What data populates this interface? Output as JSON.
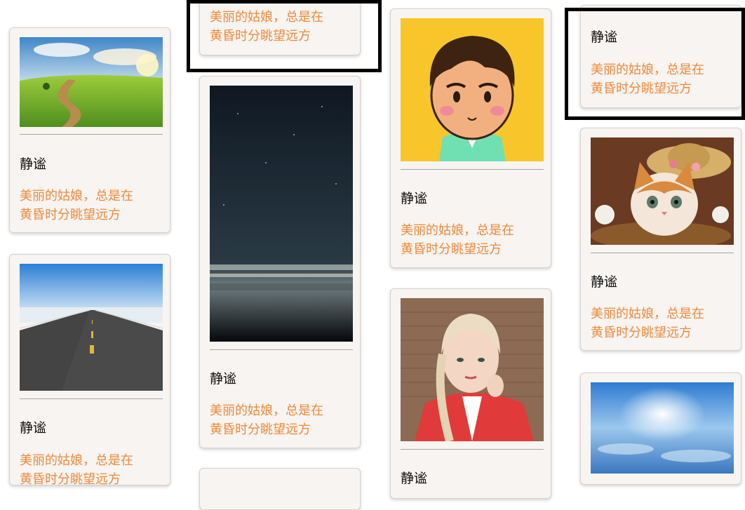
{
  "cards": [
    {
      "name": "静谧",
      "desc_line1": "美丽的姑娘，总是在",
      "desc_line2": "黄昏时分眺望远方",
      "image": "green-hills-landscape-photo"
    },
    {
      "name": "静谧",
      "desc_line1": "美丽的姑娘，总是在",
      "desc_line2": "黄昏时分眺望远方",
      "image": "road-horizon-photo"
    },
    {
      "name": "",
      "desc_line1": "美丽的姑娘，总是在",
      "desc_line2": "黄昏时分眺望远方",
      "image": ""
    },
    {
      "name": "静谧",
      "desc_line1": "美丽的姑娘，总是在",
      "desc_line2": "黄昏时分眺望远方",
      "image": "night-sky-sea-photo"
    },
    {
      "name": "静谧",
      "desc_line1": "美丽的姑娘，总是在",
      "desc_line2": "黄昏时分眺望远方",
      "image": "cartoon-boy-avatar"
    },
    {
      "name": "静谧",
      "desc_line1": "",
      "desc_line2": "",
      "image": "girl-with-braids-photo"
    },
    {
      "name": "静谧",
      "desc_line1": "美丽的姑娘，总是在",
      "desc_line2": "黄昏时分眺望远方",
      "image": ""
    },
    {
      "name": "静谧",
      "desc_line1": "美丽的姑娘，总是在",
      "desc_line2": "黄昏时分眺望远方",
      "image": "kitten-in-hat-photo"
    },
    {
      "name": "",
      "desc_line1": "",
      "desc_line2": "",
      "image": "sky-clouds-photo"
    }
  ],
  "highlight_color": "#000000",
  "desc_color": "#f08a3a"
}
